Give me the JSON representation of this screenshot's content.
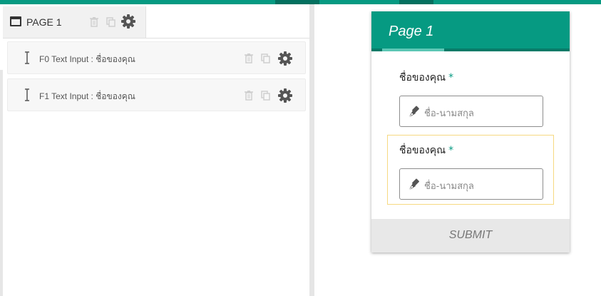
{
  "builder": {
    "page_tab": {
      "label": "PAGE 1"
    },
    "fields": [
      {
        "label": "F0 Text Input : ชื่อของคุณ"
      },
      {
        "label": "F1 Text Input : ชื่อของคุณ"
      }
    ],
    "icons": {
      "page": "window-icon",
      "delete": "trash-icon",
      "duplicate": "copy-icon",
      "settings": "gear-icon",
      "field": "text-cursor-icon"
    }
  },
  "preview": {
    "title": "Page 1",
    "questions": [
      {
        "label": "ชื่อของคุณ",
        "required_mark": "*",
        "placeholder": "ชื่อ-นามสกุล"
      },
      {
        "label": "ชื่อของคุณ",
        "required_mark": "*",
        "placeholder": "ชื่อ-นามสกุล"
      }
    ],
    "submit_label": "SUBMIT"
  },
  "colors": {
    "accent": "#069a82",
    "accent_dark": "#057a67",
    "selected_border": "#f6d981"
  }
}
